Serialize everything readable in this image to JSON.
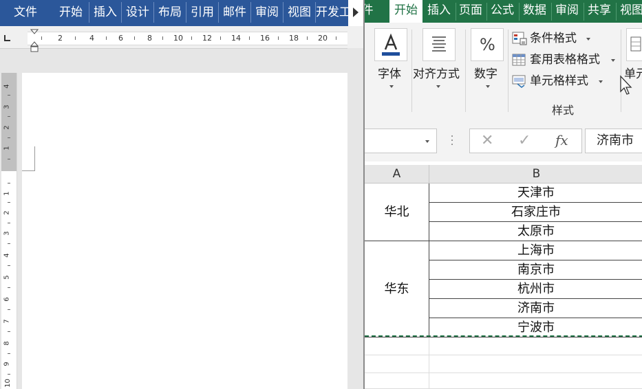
{
  "word": {
    "ribbon_tabs": [
      "文件",
      "开始",
      "插入",
      "设计",
      "布局",
      "引用",
      "邮件",
      "审阅",
      "视图",
      "开发工"
    ],
    "hruler_numbers": [
      "2",
      "4",
      "6",
      "8",
      "10",
      "12",
      "14",
      "16",
      "18",
      "20"
    ],
    "vruler_top_numbers": [
      "4",
      "3",
      "2",
      "1"
    ],
    "vruler_numbers": [
      "1",
      "2",
      "3",
      "4",
      "5",
      "6",
      "7",
      "8",
      "9",
      "10"
    ]
  },
  "excel": {
    "ribbon_tabs": [
      "件",
      "开始",
      "插入",
      "页面",
      "公式",
      "数据",
      "审阅",
      "共享",
      "视图"
    ],
    "active_tab": "开始",
    "groups": {
      "font_label": "字体",
      "align_label": "对齐方式",
      "number_label": "数字",
      "number_icon": "%",
      "cells_label": "单元",
      "styles": {
        "conditional_format": "条件格式",
        "table_format": "套用表格格式",
        "cell_style": "单元格样式",
        "group_label": "样式"
      }
    },
    "formula_bar": {
      "cancel_icon": "✕",
      "enter_icon": "✓",
      "fx_label": "fx",
      "value": "济南市"
    },
    "column_headers": [
      "A",
      "B"
    ],
    "regions": [
      {
        "name": "华北",
        "cities": [
          "天津市",
          "石家庄市",
          "太原市"
        ]
      },
      {
        "name": "华东",
        "cities": [
          "上海市",
          "南京市",
          "杭州市",
          "济南市",
          "宁波市"
        ]
      }
    ]
  }
}
